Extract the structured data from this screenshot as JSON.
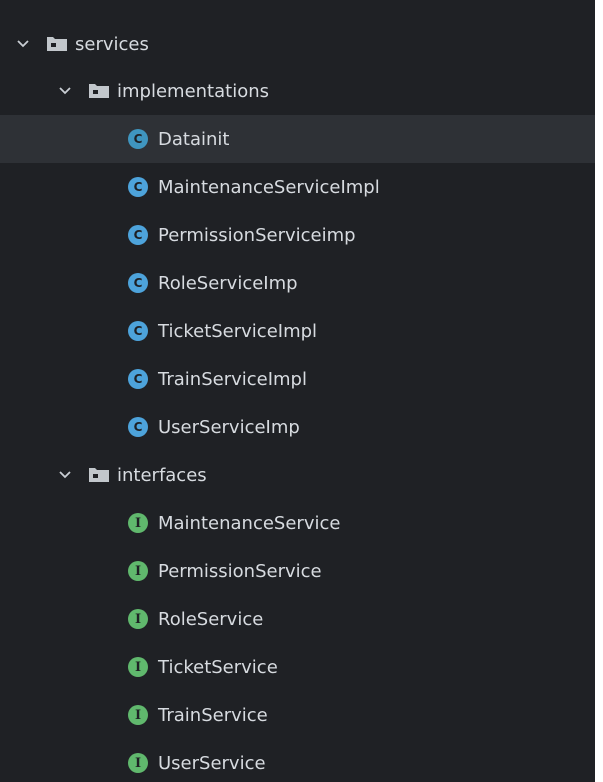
{
  "colors": {
    "background": "#1f2125",
    "selection": "#2e3136",
    "text": "#d7dbe0",
    "class_badge": "#4da3db",
    "interface_badge": "#60b86d"
  },
  "tree": {
    "root_folder": {
      "label": "services",
      "expanded": true,
      "icon": "folder-icon"
    },
    "implementations_folder": {
      "label": "implementations",
      "expanded": true,
      "icon": "folder-icon"
    },
    "implementations": [
      {
        "label": "Datainit",
        "badge": "C",
        "selected": true
      },
      {
        "label": "MaintenanceServiceImpl",
        "badge": "C"
      },
      {
        "label": "PermissionServiceimp",
        "badge": "C"
      },
      {
        "label": "RoleServiceImp",
        "badge": "C"
      },
      {
        "label": "TicketServiceImpl",
        "badge": "C"
      },
      {
        "label": "TrainServiceImpl",
        "badge": "C"
      },
      {
        "label": "UserServiceImp",
        "badge": "C"
      }
    ],
    "interfaces_folder": {
      "label": "interfaces",
      "expanded": true,
      "icon": "folder-icon"
    },
    "interfaces": [
      {
        "label": "MaintenanceService",
        "badge": "I"
      },
      {
        "label": "PermissionService",
        "badge": "I"
      },
      {
        "label": "RoleService",
        "badge": "I"
      },
      {
        "label": "TicketService",
        "badge": "I"
      },
      {
        "label": "TrainService",
        "badge": "I"
      },
      {
        "label": "UserService",
        "badge": "I"
      }
    ]
  }
}
